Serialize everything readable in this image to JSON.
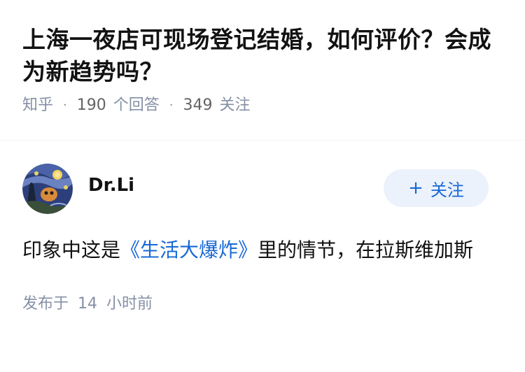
{
  "question": {
    "title": "上海一夜店可现场登记结婚，如何评价？会成为新趋势吗？",
    "source": "知乎",
    "answer_count": "190",
    "answer_label": "个回答",
    "follower_count": "349",
    "follower_label": "关注"
  },
  "answer": {
    "author_name": "Dr.Li",
    "follow_button_label": "关注",
    "content_before": "印象中这是",
    "content_link": "《生活大爆炸》",
    "content_after": "里的情节，在拉斯维加斯",
    "time_prefix": "发布于",
    "time_value": "14",
    "time_unit": "小时前"
  },
  "colors": {
    "meta_gray": "#8590a6",
    "link_blue": "#1768d6",
    "follow_bg": "#ebf2fc"
  }
}
